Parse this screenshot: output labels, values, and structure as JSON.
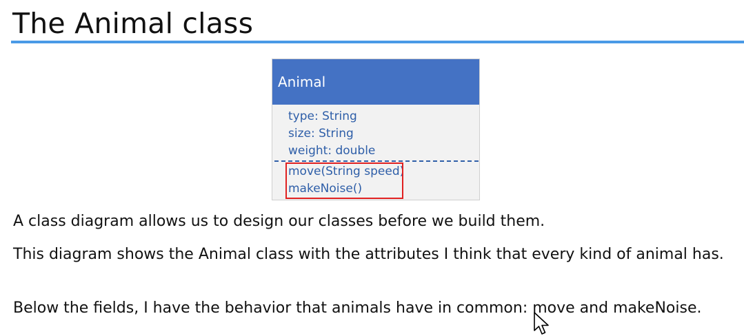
{
  "slide": {
    "title": "The Animal class"
  },
  "diagram": {
    "class_name": "Animal",
    "attributes": [
      "type: String",
      "size: String",
      "weight: double"
    ],
    "methods": [
      "move(String speed)",
      "makeNoise()"
    ],
    "colors": {
      "header": "#4472c4",
      "body": "#f2f2f2",
      "member_text": "#2e5ea8",
      "highlight": "#e02020",
      "title_rule": "#4a9ae6"
    }
  },
  "body_text": {
    "para1": "A class diagram allows us to design our classes before we build them.",
    "para2": "This diagram shows the Animal class with the attributes I think that every kind of animal has.",
    "para3": "Below the fields, I have the behavior that animals have in common: move and makeNoise."
  },
  "cursor": {
    "icon": "mouse-pointer-icon"
  }
}
